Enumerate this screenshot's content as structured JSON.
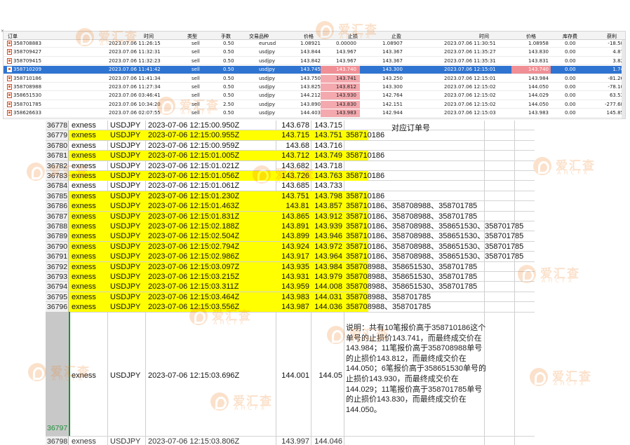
{
  "orders": {
    "columns": [
      "订单",
      "时间",
      "类型",
      "手数",
      "交易品种",
      "价格",
      "止损",
      "止盈",
      "时间",
      "价格",
      "库存费",
      "获利"
    ],
    "rows": [
      {
        "ticket": "358708883",
        "open_time": "2023.07.06 11:26:15",
        "type": "sell",
        "lots": "0.50",
        "symbol": "eurusd",
        "open_price": "1.08921",
        "sl": "0.00000",
        "tp": "1.08907",
        "close_time": "2023.07.06 11:30:51",
        "close_price": "1.08958",
        "swap": "0.00",
        "profit": "-18.50",
        "selected": false,
        "sl_hit": false
      },
      {
        "ticket": "358709427",
        "open_time": "2023.07.06 11:32:31",
        "type": "sell",
        "lots": "0.50",
        "symbol": "usdjpy",
        "open_price": "143.844",
        "sl": "143.967",
        "tp": "143.367",
        "close_time": "2023.07.06 11:35:27",
        "close_price": "143.830",
        "swap": "0.00",
        "profit": "4.87",
        "selected": false,
        "sl_hit": false
      },
      {
        "ticket": "358709415",
        "open_time": "2023.07.06 11:32:23",
        "type": "sell",
        "lots": "0.50",
        "symbol": "usdjpy",
        "open_price": "143.842",
        "sl": "143.967",
        "tp": "143.367",
        "close_time": "2023.07.06 11:35:31",
        "close_price": "143.831",
        "swap": "0.00",
        "profit": "3.82",
        "selected": false,
        "sl_hit": false
      },
      {
        "ticket": "358710209",
        "open_time": "2023.07.06 11:41:42",
        "type": "sell",
        "lots": "0.50",
        "symbol": "usdjpy",
        "open_price": "143.745",
        "sl": "143.740",
        "tp": "143.300",
        "close_time": "2023.07.06 12:15:01",
        "close_price": "143.740",
        "swap": "0.00",
        "profit": "1.74",
        "selected": true,
        "sl_hit": true
      },
      {
        "ticket": "358710186",
        "open_time": "2023.07.06 11:41:34",
        "type": "sell",
        "lots": "0.50",
        "symbol": "usdjpy",
        "open_price": "143.750",
        "sl": "143.741",
        "tp": "143.250",
        "close_time": "2023.07.06 12:15:01",
        "close_price": "143.984",
        "swap": "0.00",
        "profit": "-81.26",
        "selected": false,
        "sl_hit": true
      },
      {
        "ticket": "358708988",
        "open_time": "2023.07.06 11:27:34",
        "type": "sell",
        "lots": "0.50",
        "symbol": "usdjpy",
        "open_price": "143.825",
        "sl": "143.812",
        "tp": "143.300",
        "close_time": "2023.07.06 12:15:02",
        "close_price": "144.050",
        "swap": "0.00",
        "profit": "-78.10",
        "selected": false,
        "sl_hit": true
      },
      {
        "ticket": "358651530",
        "open_time": "2023.07.06 03:46:41",
        "type": "sell",
        "lots": "0.50",
        "symbol": "usdjpy",
        "open_price": "144.212",
        "sl": "143.930",
        "tp": "142.764",
        "close_time": "2023.07.06 12:15:02",
        "close_price": "144.029",
        "swap": "0.00",
        "profit": "63.53",
        "selected": false,
        "sl_hit": true
      },
      {
        "ticket": "358701785",
        "open_time": "2023.07.06 10:34:20",
        "type": "sell",
        "lots": "2.50",
        "symbol": "usdjpy",
        "open_price": "143.890",
        "sl": "143.830",
        "tp": "142.151",
        "close_time": "2023.07.06 12:15:02",
        "close_price": "144.050",
        "swap": "0.00",
        "profit": "-277.68",
        "selected": false,
        "sl_hit": true
      },
      {
        "ticket": "358626633",
        "open_time": "2023.07.06 02:07:55",
        "type": "sell",
        "lots": "0.50",
        "symbol": "usdjpy",
        "open_price": "144.403",
        "sl": "143.983",
        "tp": "142.944",
        "close_time": "2023.07.06 12:15:03",
        "close_price": "143.983",
        "swap": "0.00",
        "profit": "145.85",
        "selected": false,
        "sl_hit": true
      }
    ]
  },
  "sheet": {
    "header_note": "对应订单号",
    "rows": [
      {
        "num": "36778",
        "broker": "exness",
        "symbol": "USDJPY",
        "time": "2023-07-06 12:15:00.950Z",
        "bid": "143.678",
        "ask": "143.715",
        "orders": "",
        "hl": false
      },
      {
        "num": "36779",
        "broker": "exness",
        "symbol": "USDJPY",
        "time": "2023-07-06 12:15:00.955Z",
        "bid": "143.715",
        "ask": "143.751",
        "orders": "358710186",
        "hl": true
      },
      {
        "num": "36780",
        "broker": "exness",
        "symbol": "USDJPY",
        "time": "2023-07-06 12:15:00.959Z",
        "bid": "143.68",
        "ask": "143.716",
        "orders": "",
        "hl": false
      },
      {
        "num": "36781",
        "broker": "exness",
        "symbol": "USDJPY",
        "time": "2023-07-06 12:15:01.005Z",
        "bid": "143.712",
        "ask": "143.749",
        "orders": "358710186",
        "hl": true
      },
      {
        "num": "36782",
        "broker": "exness",
        "symbol": "USDJPY",
        "time": "2023-07-06 12:15:01.021Z",
        "bid": "143.682",
        "ask": "143.718",
        "orders": "",
        "hl": false
      },
      {
        "num": "36783",
        "broker": "exness",
        "symbol": "USDJPY",
        "time": "2023-07-06 12:15:01.056Z",
        "bid": "143.726",
        "ask": "143.763",
        "orders": "358710186",
        "hl": true
      },
      {
        "num": "36784",
        "broker": "exness",
        "symbol": "USDJPY",
        "time": "2023-07-06 12:15:01.061Z",
        "bid": "143.685",
        "ask": "143.733",
        "orders": "",
        "hl": false
      },
      {
        "num": "36785",
        "broker": "exness",
        "symbol": "USDJPY",
        "time": "2023-07-06 12:15:01.230Z",
        "bid": "143.751",
        "ask": "143.798",
        "orders": "358710186",
        "hl": true
      },
      {
        "num": "36786",
        "broker": "exness",
        "symbol": "USDJPY",
        "time": "2023-07-06 12:15:01.463Z",
        "bid": "143.81",
        "ask": "143.857",
        "orders": "358710186、358708988、358701785",
        "hl": true
      },
      {
        "num": "36787",
        "broker": "exness",
        "symbol": "USDJPY",
        "time": "2023-07-06 12:15:01.831Z",
        "bid": "143.865",
        "ask": "143.912",
        "orders": "358710186、358708988、358701785",
        "hl": true
      },
      {
        "num": "36788",
        "broker": "exness",
        "symbol": "USDJPY",
        "time": "2023-07-06 12:15:02.188Z",
        "bid": "143.891",
        "ask": "143.939",
        "orders": "358710186、358708988、358651530、358701785",
        "hl": true
      },
      {
        "num": "36789",
        "broker": "exness",
        "symbol": "USDJPY",
        "time": "2023-07-06 12:15:02.504Z",
        "bid": "143.899",
        "ask": "143.946",
        "orders": "358710186、358708988、358651530、358701785",
        "hl": true
      },
      {
        "num": "36790",
        "broker": "exness",
        "symbol": "USDJPY",
        "time": "2023-07-06 12:15:02.794Z",
        "bid": "143.924",
        "ask": "143.972",
        "orders": "358710186、358708988、358651530、358701785",
        "hl": true
      },
      {
        "num": "36791",
        "broker": "exness",
        "symbol": "USDJPY",
        "time": "2023-07-06 12:15:02.986Z",
        "bid": "143.917",
        "ask": "143.964",
        "orders": "358710186、358708988、358651530、358701785",
        "hl": true
      },
      {
        "num": "36792",
        "broker": "exness",
        "symbol": "USDJPY",
        "time": "2023-07-06 12:15:03.097Z",
        "bid": "143.935",
        "ask": "143.984",
        "orders": "358708988、358651530、358701785",
        "hl": true
      },
      {
        "num": "36793",
        "broker": "exness",
        "symbol": "USDJPY",
        "time": "2023-07-06 12:15:03.215Z",
        "bid": "143.931",
        "ask": "143.979",
        "orders": "358708988、358651530、358701785",
        "hl": true
      },
      {
        "num": "36794",
        "broker": "exness",
        "symbol": "USDJPY",
        "time": "2023-07-06 12:15:03.311Z",
        "bid": "143.959",
        "ask": "144.008",
        "orders": "358708988、358651530、358701785",
        "hl": true
      },
      {
        "num": "36795",
        "broker": "exness",
        "symbol": "USDJPY",
        "time": "2023-07-06 12:15:03.464Z",
        "bid": "143.983",
        "ask": "144.031",
        "orders": "358708988、358701785",
        "hl": true
      },
      {
        "num": "36796",
        "broker": "exness",
        "symbol": "USDJPY",
        "time": "2023-07-06 12:15:03.556Z",
        "bid": "143.987",
        "ask": "144.036",
        "orders": "358708988、358701785",
        "hl": true
      }
    ],
    "tall_row": {
      "num": "36797",
      "broker": "exness",
      "symbol": "USDJPY",
      "time": "2023-07-06 12:15:03.696Z",
      "bid": "144.001",
      "ask": "144.05",
      "note": "说明：共有10笔报价高于358710186这个单号的止损价143.741，而最终成交价在143.984；11笔报价高于358708988单号的止损价143.812，而最终成交价在144.050；6笔报价高于358651530单号的止损价143.930，而最终成交价在144.029；11笔报价高于358701785单号的止损价143.830，而最终成交价在144.050。"
    },
    "cut_row": {
      "num": "36798",
      "broker": "exness",
      "symbol": "USDJPY",
      "time": "2023-07-06 12:15:03.806Z",
      "bid": "143.997",
      "ask": "144.046"
    }
  },
  "watermark": {
    "brand": "爱汇查",
    "sub": "AHCFX"
  },
  "colors": {
    "highlight": "#ffff00",
    "selection": "#2f74d0",
    "sl_hit": "#f3a9ae",
    "watermark": "#f07a18"
  }
}
